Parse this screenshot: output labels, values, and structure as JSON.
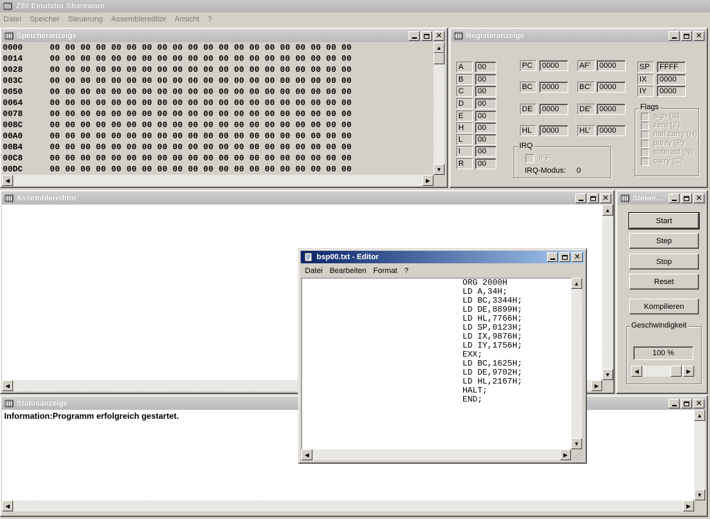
{
  "app": {
    "title": "Z80 Emulator Shareware",
    "menu": [
      "Datei",
      "Speicher",
      "Steuerung",
      "Assemblereditor",
      "Ansicht",
      "?"
    ]
  },
  "memory_window": {
    "title": "Speicheranzeige",
    "rows": [
      {
        "addr": "0000",
        "bytes": "00 00 00 00 00 00 00 00 00 00 00 00 00 00 00 00 00 00 00 00"
      },
      {
        "addr": "0014",
        "bytes": "00 00 00 00 00 00 00 00 00 00 00 00 00 00 00 00 00 00 00 00"
      },
      {
        "addr": "0028",
        "bytes": "00 00 00 00 00 00 00 00 00 00 00 00 00 00 00 00 00 00 00 00"
      },
      {
        "addr": "003C",
        "bytes": "00 00 00 00 00 00 00 00 00 00 00 00 00 00 00 00 00 00 00 00"
      },
      {
        "addr": "0050",
        "bytes": "00 00 00 00 00 00 00 00 00 00 00 00 00 00 00 00 00 00 00 00"
      },
      {
        "addr": "0064",
        "bytes": "00 00 00 00 00 00 00 00 00 00 00 00 00 00 00 00 00 00 00 00"
      },
      {
        "addr": "0078",
        "bytes": "00 00 00 00 00 00 00 00 00 00 00 00 00 00 00 00 00 00 00 00"
      },
      {
        "addr": "008C",
        "bytes": "00 00 00 00 00 00 00 00 00 00 00 00 00 00 00 00 00 00 00 00"
      },
      {
        "addr": "00A0",
        "bytes": "00 00 00 00 00 00 00 00 00 00 00 00 00 00 00 00 00 00 00 00"
      },
      {
        "addr": "00B4",
        "bytes": "00 00 00 00 00 00 00 00 00 00 00 00 00 00 00 00 00 00 00 00"
      },
      {
        "addr": "00C8",
        "bytes": "00 00 00 00 00 00 00 00 00 00 00 00 00 00 00 00 00 00 00 00"
      },
      {
        "addr": "00DC",
        "bytes": "00 00 00 00 00 00 00 00 00 00 00 00 00 00 00 00 00 00 00 00"
      }
    ]
  },
  "register_window": {
    "title": "Registeranzeige",
    "regs8": [
      {
        "name": "A",
        "value": "00"
      },
      {
        "name": "B",
        "value": "00"
      },
      {
        "name": "C",
        "value": "00"
      },
      {
        "name": "D",
        "value": "00"
      },
      {
        "name": "E",
        "value": "00"
      },
      {
        "name": "H",
        "value": "00"
      },
      {
        "name": "L",
        "value": "00"
      },
      {
        "name": "I",
        "value": "00"
      },
      {
        "name": "R",
        "value": "00"
      }
    ],
    "regs16": [
      {
        "name": "PC",
        "value": "0000"
      },
      {
        "name": "BC",
        "value": "0000"
      },
      {
        "name": "DE",
        "value": "0000"
      },
      {
        "name": "HL",
        "value": "0000"
      }
    ],
    "regs16_alt": [
      {
        "name": "AF'",
        "value": "0000"
      },
      {
        "name": "BC'",
        "value": "0000"
      },
      {
        "name": "DE'",
        "value": "0000"
      },
      {
        "name": "HL'",
        "value": "0000"
      }
    ],
    "regs_sp": [
      {
        "name": "SP",
        "value": "FFFF"
      },
      {
        "name": "IX",
        "value": "0000"
      },
      {
        "name": "IY",
        "value": "0000"
      }
    ],
    "flags": {
      "title": "Flags",
      "items": [
        "sign (S)",
        "zero (Z)",
        "half carry (H)",
        "parity (P)",
        "subtract (N)",
        "carry (C)"
      ]
    },
    "irq": {
      "title": "IRQ",
      "iff_label": "IFF",
      "mode_label": "IRQ-Modus:",
      "mode_value": "0"
    }
  },
  "assembler_window": {
    "title": "Assemblereditor"
  },
  "control_window": {
    "title": "Steuer...",
    "buttons": [
      "Start",
      "Step",
      "Stop",
      "Reset",
      "Kompilieren"
    ],
    "speed": {
      "title": "Geschwindigkeit",
      "value": "100 %"
    }
  },
  "status_window": {
    "title": "Statusanzeige",
    "message": "Information:Programm erfolgreich gestartet."
  },
  "editor": {
    "title": "bsp00.txt - Editor",
    "menu": [
      "Datei",
      "Bearbeiten",
      "Format",
      "?"
    ],
    "code": "ORG 2000H\nLD A,34H;\nLD BC,3344H;\nLD DE,8899H;\nLD HL,7766H;\nLD SP,0123H;\nLD IX,9876H;\nLD IY,1756H;\nEXX;\nLD BC,1625H;\nLD DE,9702H;\nLD HL,2167H;\nHALT;\nEND;"
  }
}
